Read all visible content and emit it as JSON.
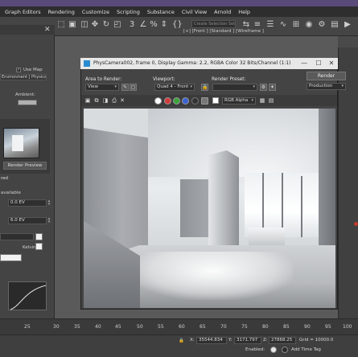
{
  "menu": [
    "Graph Editors",
    "Rendering",
    "Customize",
    "Scripting",
    "Substance",
    "Civil View",
    "Arnold",
    "Help"
  ],
  "toolbar": {
    "selection_set_placeholder": "Create Selection Set",
    "viewport_label": "[+] [Front ] [Standard ] [Wireframe ]"
  },
  "left_panel": {
    "use_map": "Use Map",
    "environment_field": "Environment [ Physical Su",
    "ambient_label": "Ambient:",
    "render_preview": "Render Preview",
    "exposure_section": "red",
    "available": "available",
    "ev1": "0.0 EV",
    "ev2": "6.0 EV",
    "kelvin": "Kelvin"
  },
  "render_frame": {
    "title": "PhysCamera002, frame 0, Display Gamma: 2.2, RGBA Color 32 Bits/Channel (1:1)",
    "area_to_render_label": "Area to Render:",
    "area_to_render_value": "View",
    "viewport_label": "Viewport:",
    "viewport_value": "Quad 4 - Front",
    "render_preset_label": "Render Preset:",
    "render_preset_value": "",
    "render_button": "Render",
    "render_mode": "Production",
    "channel": "RGB Alpha"
  },
  "timeline": {
    "ticks": [
      "25",
      "30",
      "35",
      "40",
      "45",
      "50",
      "55",
      "60",
      "65",
      "70",
      "75",
      "80",
      "85",
      "90",
      "95",
      "100"
    ]
  },
  "status": {
    "x_label": "X:",
    "x_value": "35544.834",
    "y_label": "Y:",
    "y_value": "3171.797",
    "z_label": "Z:",
    "z_value": "27868.25",
    "grid": "Grid = 10000.0",
    "enabled": "Enabled:",
    "add_time_tag": "Add Time Tag"
  }
}
